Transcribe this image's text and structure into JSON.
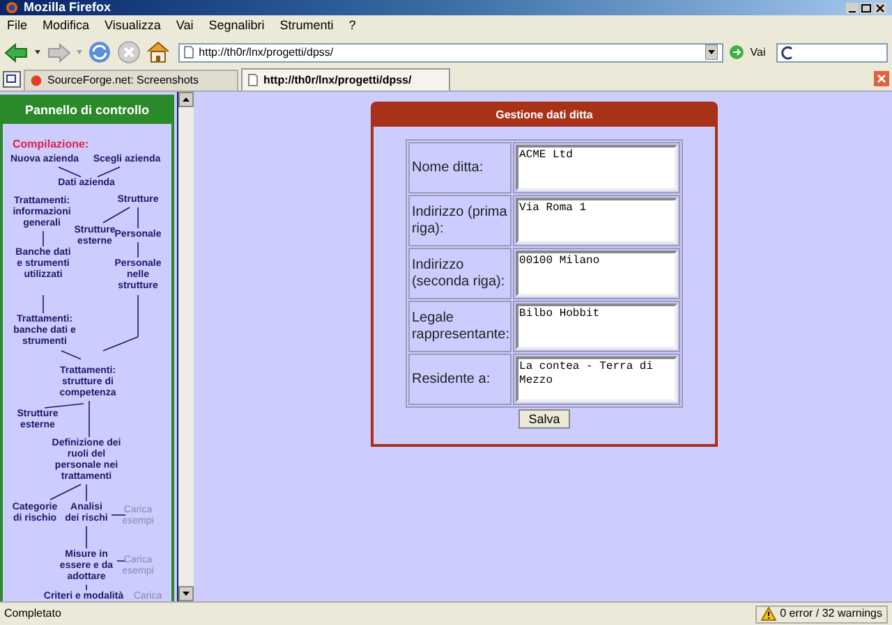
{
  "window": {
    "title": "Mozilla Firefox"
  },
  "menu": [
    "File",
    "Modifica",
    "Visualizza",
    "Vai",
    "Segnalibri",
    "Strumenti",
    "?"
  ],
  "toolbar": {
    "url": "http://th0r/lnx/progetti/dpss/",
    "go_label": "Vai"
  },
  "tabs": [
    {
      "label": "SourceForge.net: Screenshots",
      "selected": false
    },
    {
      "label": "http://th0r/lnx/progetti/dpss/",
      "selected": true
    }
  ],
  "control_panel": {
    "title": "Pannello di controllo",
    "section": "Compilazione:",
    "nodes": [
      {
        "label": "Nuova azienda",
        "kind": "step"
      },
      {
        "label": "Scegli azienda",
        "kind": "step"
      },
      {
        "label": "Dati azienda",
        "kind": "step"
      },
      {
        "label": "Trattamenti: informazioni generali",
        "kind": "step"
      },
      {
        "label": "Strutture",
        "kind": "step"
      },
      {
        "label": "Strutture esterne",
        "kind": "step"
      },
      {
        "label": "Personale",
        "kind": "step"
      },
      {
        "label": "Banche dati e strumenti utilizzati",
        "kind": "step"
      },
      {
        "label": "Personale nelle strutture",
        "kind": "step"
      },
      {
        "label": "Trattamenti: banche dati e strumenti",
        "kind": "step"
      },
      {
        "label": "Trattamenti: strutture di competenza",
        "kind": "step"
      },
      {
        "label": "Strutture esterne",
        "kind": "step"
      },
      {
        "label": "Definizione dei ruoli del personale nei trattamenti",
        "kind": "step"
      },
      {
        "label": "Categorie di rischio",
        "kind": "step"
      },
      {
        "label": "Analisi dei rischi",
        "kind": "step"
      },
      {
        "label": "Carica esempi",
        "kind": "action"
      },
      {
        "label": "Misure in essere e da adottare",
        "kind": "step"
      },
      {
        "label": "Carica esempi",
        "kind": "action"
      },
      {
        "label": "Criteri e modalità",
        "kind": "step"
      },
      {
        "label": "Carica",
        "kind": "action"
      }
    ]
  },
  "form": {
    "title": "Gestione dati ditta",
    "fields": [
      {
        "label": "Nome ditta:",
        "value": "ACME Ltd"
      },
      {
        "label": "Indirizzo (prima riga):",
        "value": "Via Roma 1"
      },
      {
        "label": "Indirizzo (seconda riga):",
        "value": "00100 Milano"
      },
      {
        "label": "Legale rappresentante:",
        "value": "Bilbo Hobbit"
      },
      {
        "label": "Residente a:",
        "value": "La contea - Terra di Mezzo"
      }
    ],
    "submit": "Salva"
  },
  "status_bar": {
    "text": "Completato",
    "warnings": "0 error / 32 warnings"
  }
}
